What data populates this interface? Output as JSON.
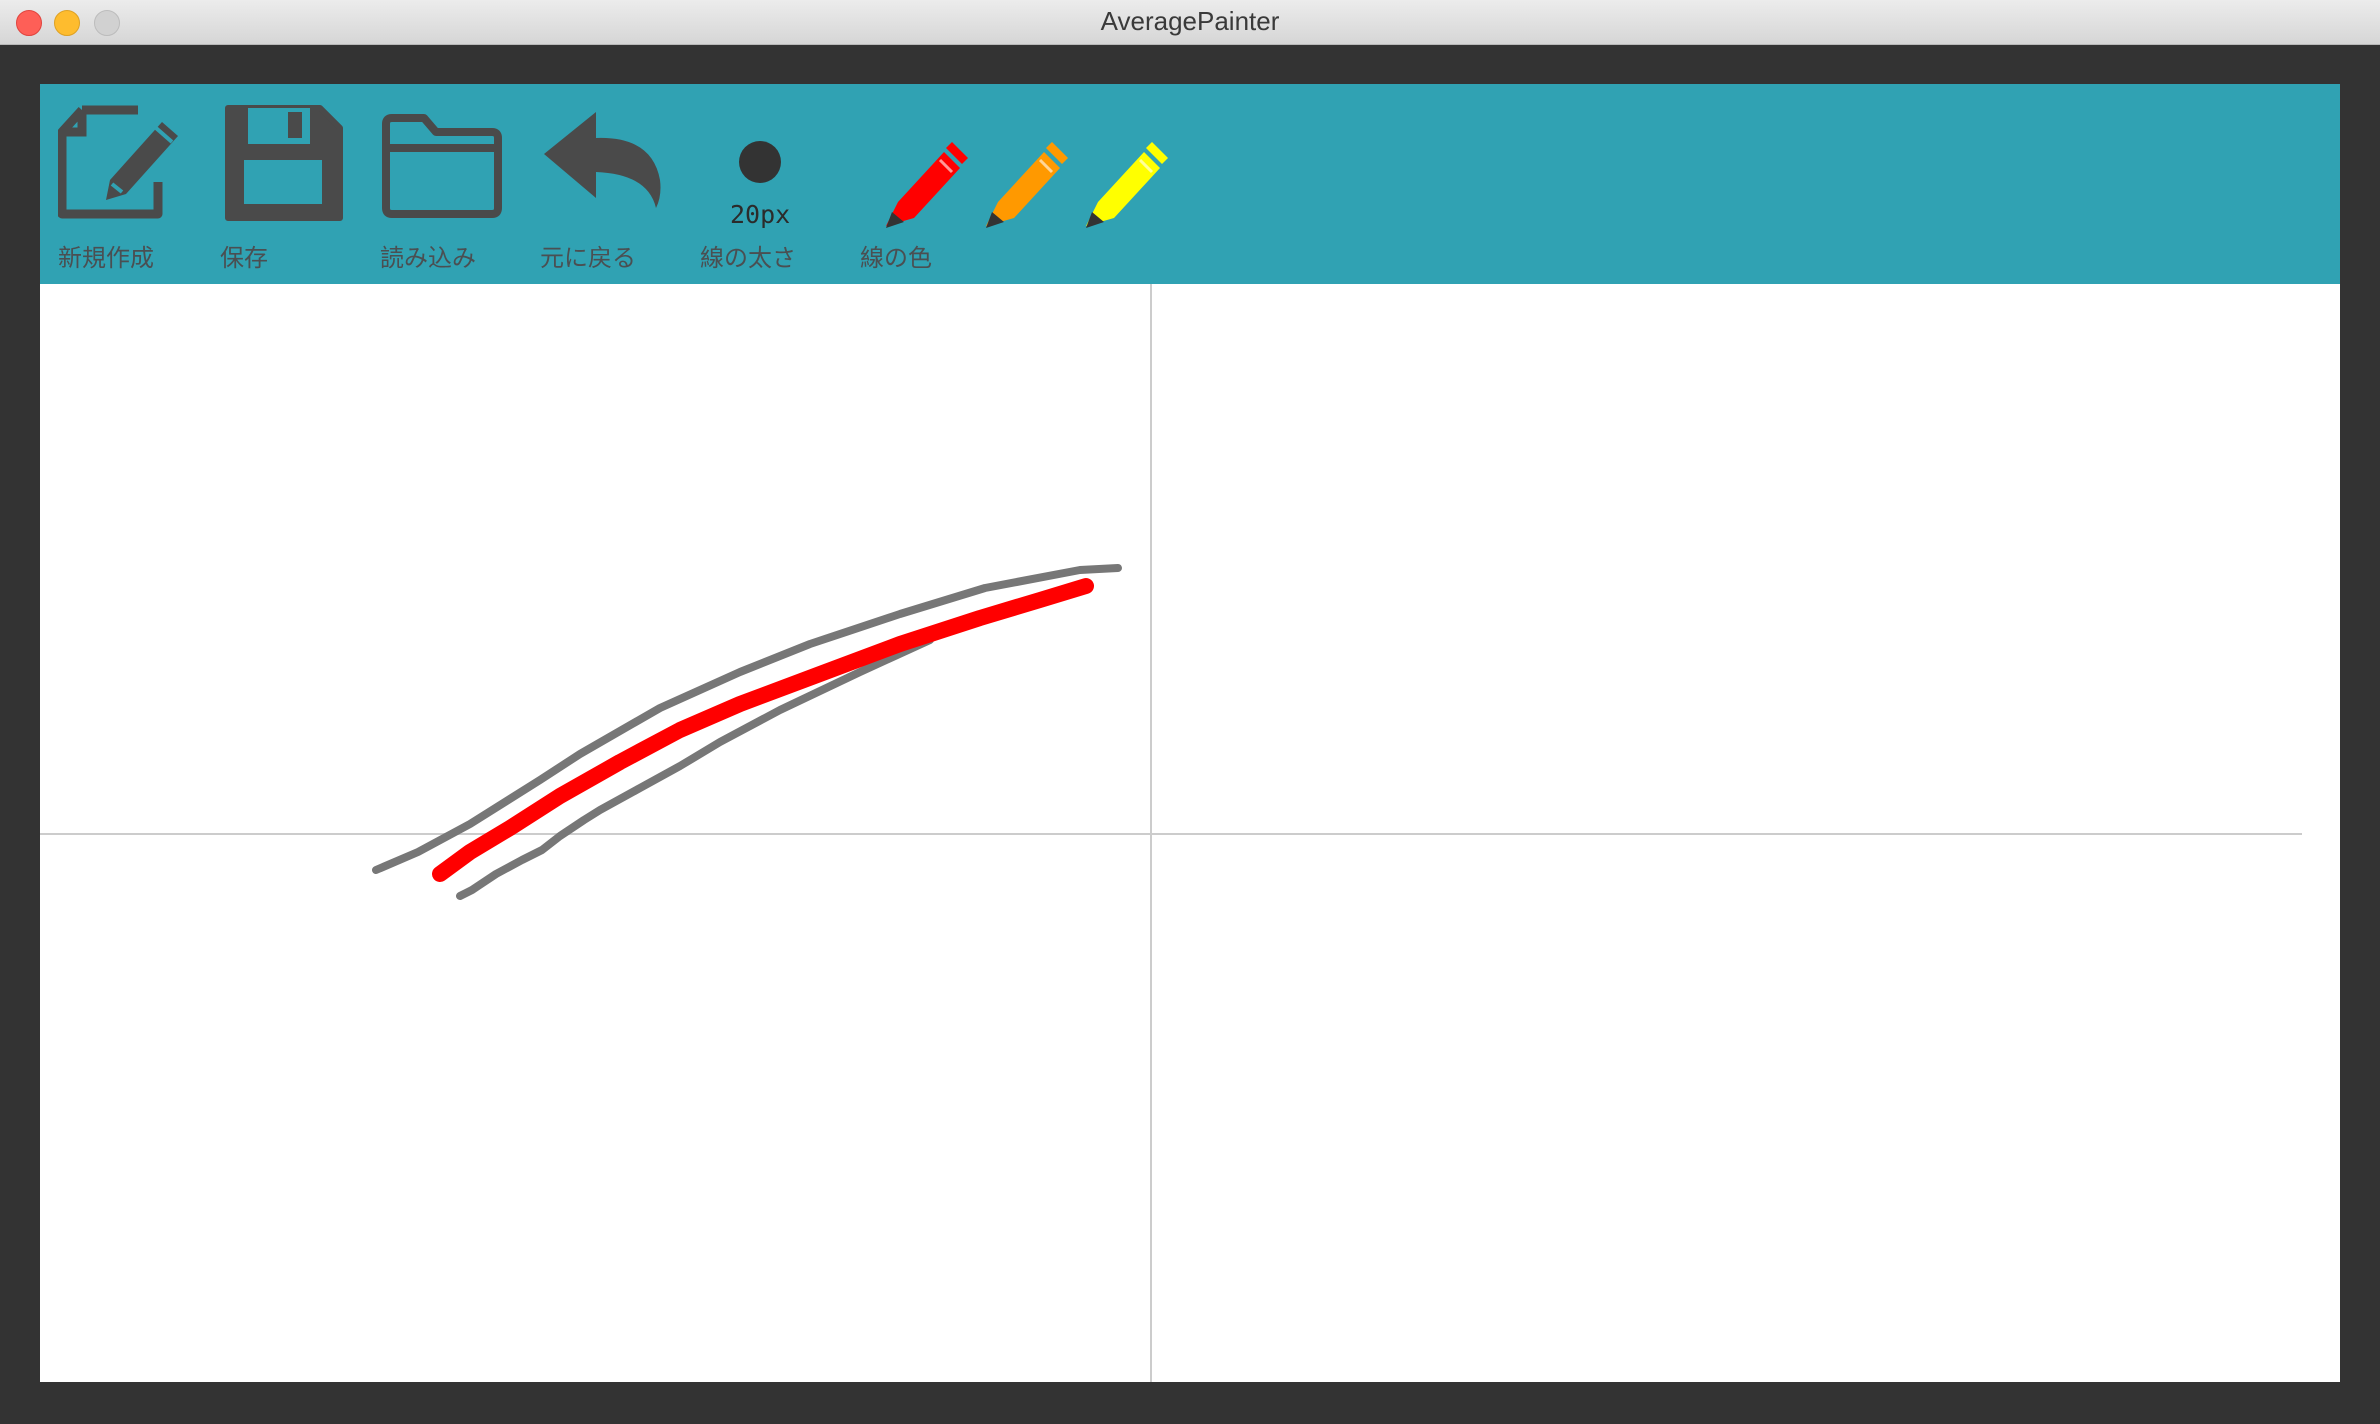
{
  "window": {
    "title": "AveragePainter"
  },
  "toolbar": {
    "new_label": "新規作成",
    "save_label": "保存",
    "load_label": "読み込み",
    "undo_label": "元に戻る",
    "width_label": "線の太さ",
    "width_value": "20px",
    "color_label": "線の色",
    "background": "#30a2b3",
    "icon_color": "#4a4a4a"
  },
  "pens": [
    {
      "name": "red-pencil-icon",
      "color": "#ff0000"
    },
    {
      "name": "orange-pencil-icon",
      "color": "#ff9900"
    },
    {
      "name": "yellow-pencil-icon",
      "color": "#ffff00"
    }
  ],
  "canvas": {
    "background": "#ffffff",
    "axis_color": "#cccccc",
    "gray_stroke_color": "#777777",
    "average_stroke_color": "#ff0000"
  }
}
